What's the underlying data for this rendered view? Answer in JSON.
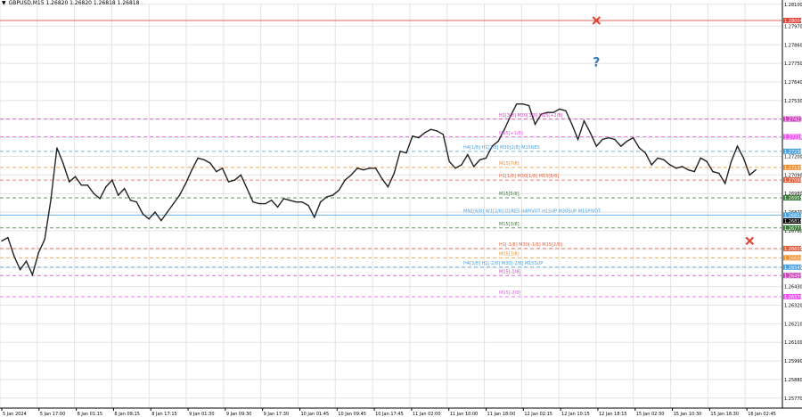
{
  "window": {
    "title_arrow": "▼",
    "symbol_info": "GBPUSD,M15  1.26820 1.26820 1.26818 1.26818"
  },
  "chart_data": {
    "type": "line",
    "title": "GBPUSD,M15  1.26820 1.26820 1.26818 1.26818",
    "symbol": "GBPUSD",
    "timeframe": "M15",
    "ylim": [
      1.25711,
      1.28104
    ],
    "yticks": [
      "1.28100",
      "1.27970",
      "1.27860",
      "1.27750",
      "1.27640",
      "1.27530",
      "1.27420",
      "1.27310",
      "1.27200",
      "1.27090",
      "1.26980",
      "1.26870",
      "1.26760",
      "1.26650",
      "1.26540",
      "1.26430",
      "1.26320",
      "1.26210",
      "1.26100",
      "1.25990",
      "1.25880",
      "1.25770"
    ],
    "xticks": [
      "5 Jan 2024",
      "5 Jan 17:00",
      "8 Jan 01:15",
      "8 Jan 09:15",
      "8 Jan 17:15",
      "9 Jan 01:30",
      "9 Jan 09:30",
      "9 Jan 17:30",
      "10 Jan 01:45",
      "10 Jan 09:45",
      "10 Jan 17:45",
      "11 Jan 02:00",
      "11 Jan 10:00",
      "11 Jan 18:00",
      "12 Jan 02:15",
      "12 Jan 10:15",
      "12 Jan 18:15",
      "15 Jan 02:30",
      "15 Jan 10:30",
      "15 Jan 18:30",
      "16 Jan 02:45"
    ],
    "series": [
      {
        "color": "#222222",
        "values": [
          1.267,
          1.2672,
          1.2661,
          1.2653,
          1.2658,
          1.265,
          1.2663,
          1.2671,
          1.2694,
          1.2725,
          1.2716,
          1.2705,
          1.2708,
          1.2703,
          1.2703,
          1.2698,
          1.2695,
          1.2702,
          1.2706,
          1.2697,
          1.2701,
          1.2694,
          1.2693,
          1.2686,
          1.2683,
          1.2687,
          1.2682,
          1.2687,
          1.2692,
          1.2697,
          1.2704,
          1.2712,
          1.2719,
          1.2718,
          1.2716,
          1.2711,
          1.2713,
          1.2705,
          1.2706,
          1.2709,
          1.2701,
          1.2693,
          1.2692,
          1.2692,
          1.2694,
          1.269,
          1.2695,
          1.2694,
          1.2693,
          1.2693,
          1.2691,
          1.2684,
          1.2693,
          1.2696,
          1.2697,
          1.27,
          1.2706,
          1.2709,
          1.2713,
          1.2712,
          1.2713,
          1.2713,
          1.2707,
          1.2702,
          1.271,
          1.2723,
          1.2722,
          1.2732,
          1.2731,
          1.2734,
          1.2736,
          1.2735,
          1.2733,
          1.2717,
          1.2713,
          1.2715,
          1.2721,
          1.2714,
          1.2718,
          1.2719,
          1.2726,
          1.2729,
          1.2736,
          1.2744,
          1.2751,
          1.2751,
          1.275,
          1.2739,
          1.2745,
          1.2746,
          1.2746,
          1.2748,
          1.2747,
          1.2739,
          1.273,
          1.2741,
          1.2734,
          1.2726,
          1.273,
          1.2731,
          1.273,
          1.2726,
          1.2729,
          1.2731,
          1.2725,
          1.2722,
          1.2715,
          1.2719,
          1.2718,
          1.2715,
          1.2713,
          1.2714,
          1.2712,
          1.2711,
          1.2719,
          1.2717,
          1.2711,
          1.271,
          1.2704,
          1.2717,
          1.2726,
          1.2719,
          1.2709,
          1.2712
        ]
      }
    ],
    "horizontal_levels": [
      {
        "price": "1.28004",
        "color": "#e0453a",
        "style": "solid"
      },
      {
        "price": "1.27421",
        "color": "#cc44bb",
        "style": "dashed"
      },
      {
        "price": "1.27316",
        "color": "#ee55ee",
        "style": "dashed"
      },
      {
        "price": "1.27230",
        "color": "#4aa0e0",
        "style": "dashed"
      },
      {
        "price": "1.27135",
        "color": "#f09030",
        "style": "dashed"
      },
      {
        "price": "1.27060",
        "color": "#e06040",
        "style": "dashed"
      },
      {
        "price": "1.26955",
        "color": "#3a7a3a",
        "style": "dashed"
      },
      {
        "price": "1.26853",
        "color": "#4aa0e0",
        "style": "solid"
      },
      {
        "price": "1.26777",
        "color": "#3a7a3a",
        "style": "dashed"
      },
      {
        "price": "1.26655",
        "color": "#e06040",
        "style": "dashed"
      },
      {
        "price": "1.26600",
        "color": "#f09030",
        "style": "dashed"
      },
      {
        "price": "1.26545",
        "color": "#4aa0e0",
        "style": "dashed"
      },
      {
        "price": "1.26370",
        "color": "#ee55ee",
        "style": "dashed"
      },
      {
        "price": "1.26495",
        "color": "#cc44bb",
        "style": "dashed"
      }
    ],
    "level_labels": [
      {
        "text": "H1[3/8] M30[3/8] M15[+2/8]",
        "price": 1.2743,
        "color": "#cc44bb"
      },
      {
        "text": "M15[+1/8]",
        "price": 1.27325,
        "color": "#ee55ee"
      },
      {
        "text": "H4[1/8] H1[2/8] M30[2/8] M15RES",
        "price": 1.2724,
        "color": "#4aa0e0"
      },
      {
        "text": "M15[7/8]",
        "price": 1.27145,
        "color": "#f09030"
      },
      {
        "text": "H1[1/8] M30[1/8] M15[6/8]",
        "price": 1.2707,
        "color": "#e06040"
      },
      {
        "text": "M15[5/8]",
        "price": 1.26965,
        "color": "#3a7a3a"
      },
      {
        "text": "MN1[6/8] W1[2/8] D1RES H4PIVOT H1SUP M30SUP M15PIVOT",
        "price": 1.26862,
        "color": "#4aa0e0"
      },
      {
        "text": "M15[3/8]",
        "price": 1.26787,
        "color": "#3a7a3a"
      },
      {
        "text": "H1[-1/8] M30[-1/8] M15[2/8]",
        "price": 1.26665,
        "color": "#e06040"
      },
      {
        "text": "M15[1/8]",
        "price": 1.2661,
        "color": "#f09030"
      },
      {
        "text": "H4[3/8] H1[-2/8] M30[-2/8] M15SUP",
        "price": 1.26555,
        "color": "#4aa0e0"
      },
      {
        "text": "M15[-1/8]",
        "price": 1.26505,
        "color": "#cc44bb"
      },
      {
        "text": "M15[-2/8]",
        "price": 1.2638,
        "color": "#ee55ee"
      }
    ],
    "price_tags": [
      {
        "text": "1.28004",
        "color": "#e0453a"
      },
      {
        "text": "1.27421",
        "color": "#cc44bb"
      },
      {
        "text": "1.27316",
        "color": "#ee55ee"
      },
      {
        "text": "1.27230",
        "color": "#4aa0e0"
      },
      {
        "text": "1.27135",
        "color": "#f09030"
      },
      {
        "text": "1.27060",
        "color": "#e06040"
      },
      {
        "text": "1.26955",
        "color": "#3a7a3a"
      },
      {
        "text": "1.26853",
        "color": "#4aa0e0"
      },
      {
        "text": "1.26777",
        "color": "#3a7a3a"
      },
      {
        "text": "1.26818",
        "color": "#000000"
      },
      {
        "text": "1.26655",
        "color": "#e06040"
      },
      {
        "text": "1.26600",
        "color": "#f09030"
      },
      {
        "text": "1.26545",
        "color": "#4aa0e0"
      },
      {
        "text": "1.26495",
        "color": "#cc44bb"
      },
      {
        "text": "1.26370",
        "color": "#ee55ee"
      }
    ],
    "markers": [
      {
        "type": "cross",
        "x_index": 97,
        "price": 1.28004,
        "color": "#e0453a"
      },
      {
        "type": "question",
        "x_index": 97,
        "price": 1.2776,
        "color": "#3a7ab8"
      },
      {
        "type": "cross",
        "x_index": 122,
        "price": 1.267,
        "color": "#e0453a"
      }
    ],
    "grid": true,
    "colors": {
      "grid": "#e4e4e4",
      "axis": "#000000",
      "line": "#222222"
    }
  }
}
